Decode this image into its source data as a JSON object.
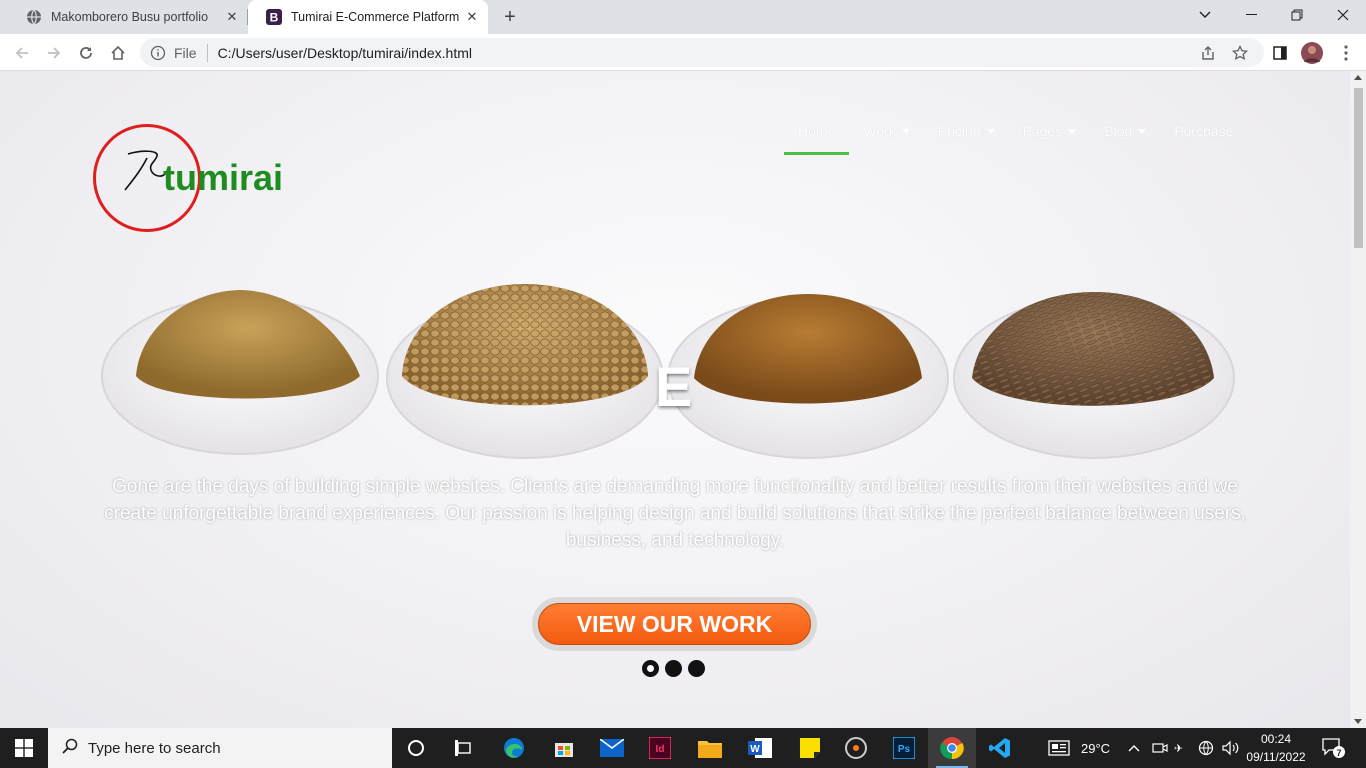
{
  "browser": {
    "tabs": [
      {
        "title": "Makomborero Busu portfolio",
        "favicon": "globe-icon"
      },
      {
        "title": "Tumirai E-Commerce Platform",
        "favicon": "bootstrap-b-icon"
      }
    ],
    "favicon_letter": "B",
    "address": {
      "security_label": "File",
      "url": "C:/Users/user/Desktop/tumirai/index.html"
    }
  },
  "page": {
    "logo_text": "tumirai",
    "nav": [
      {
        "label": "Home",
        "active": true,
        "dropdown": false
      },
      {
        "label": "Work",
        "active": false,
        "dropdown": true
      },
      {
        "label": "Pricing",
        "active": false,
        "dropdown": true
      },
      {
        "label": "Pages",
        "active": false,
        "dropdown": true
      },
      {
        "label": "Blog",
        "active": false,
        "dropdown": true
      },
      {
        "label": "Purchase",
        "active": false,
        "dropdown": false
      }
    ],
    "hero_letter": "E",
    "tagline": "Gone are the days of building simple websites. Clients are demanding more functionality and better results from their websites and we create unforgettable brand experiences. Our passion is helping design and build solutions that strike the perfect balance between users, business, and technology.",
    "cta_label": "VIEW OUR WORK",
    "carousel_dots": 3,
    "carousel_active_index": 0,
    "colors": {
      "logo_ring": "#e01e1e",
      "logo_text": "#1e8c1e",
      "nav_active_underline": "#4bbf4b",
      "cta": "#f56a1e"
    }
  },
  "taskbar": {
    "search_placeholder": "Type here to search",
    "weather": "29°C",
    "time": "00:24",
    "date": "09/11/2022",
    "notification_count": "7"
  }
}
